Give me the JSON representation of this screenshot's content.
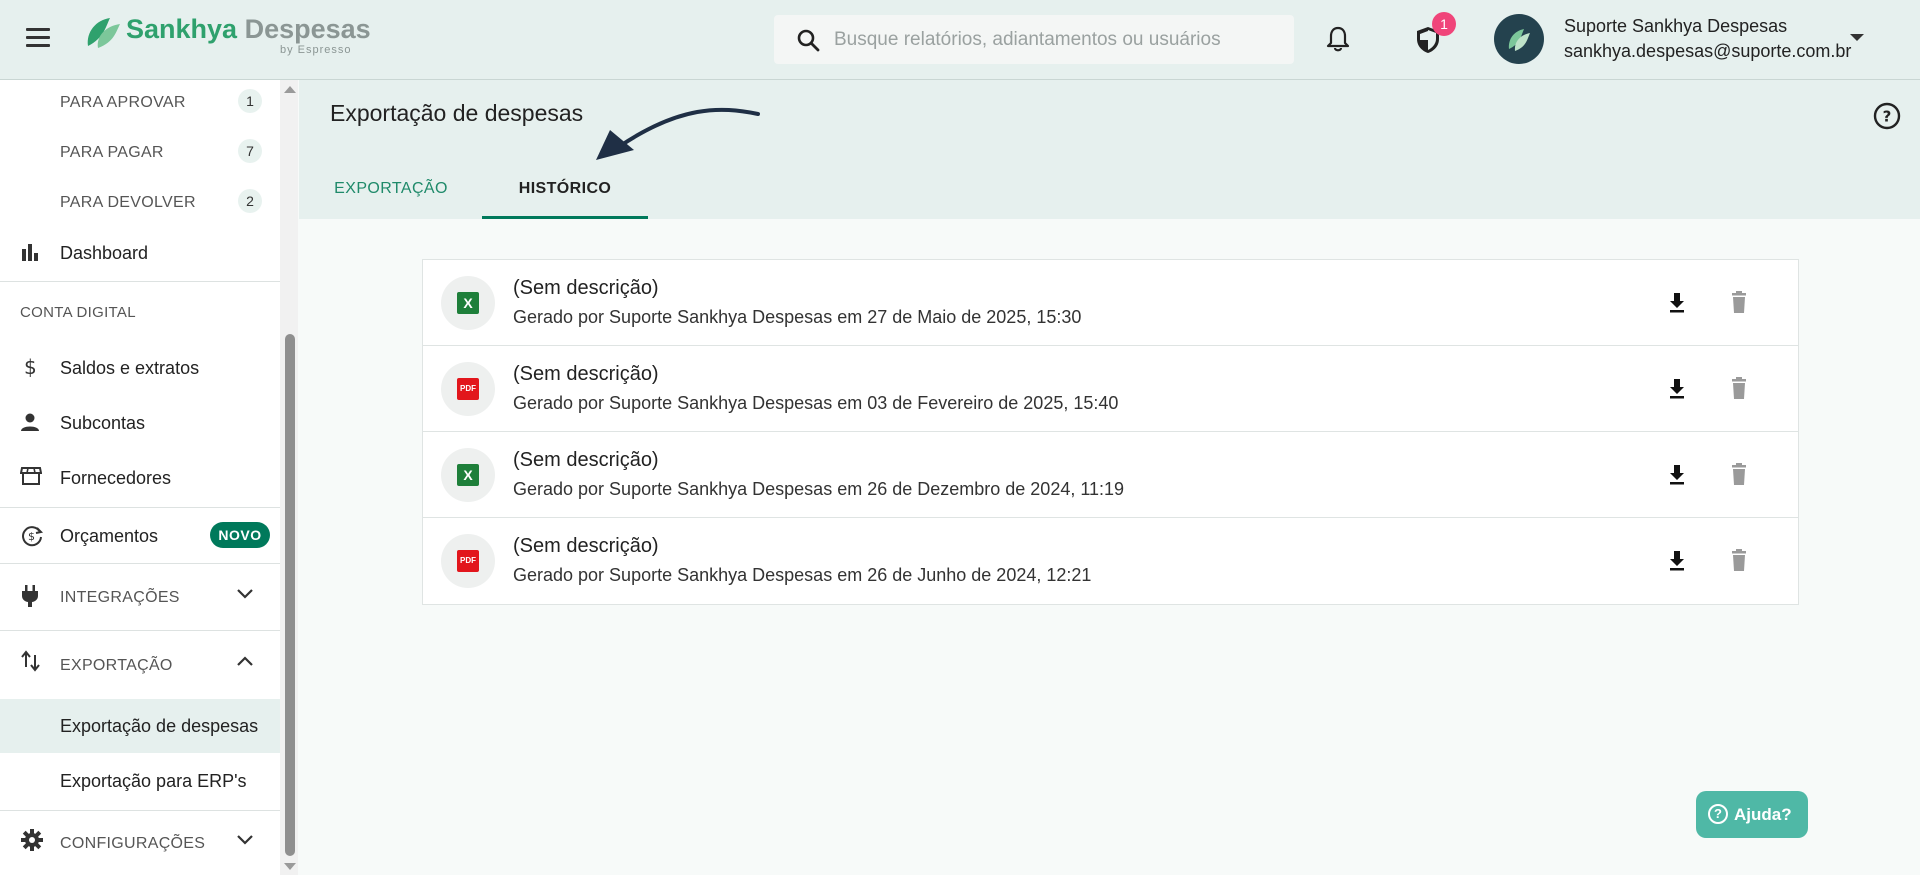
{
  "header": {
    "logo_brand": "Sankhya Despesas",
    "logo_sub": "by Espresso",
    "search_placeholder": "Busque relatórios, adiantamentos ou usuários",
    "notifications_badge": "1",
    "user_name": "Suporte Sankhya Despesas",
    "user_email": "sankhya.despesas@suporte.com.br"
  },
  "sidebar": {
    "approvals": [
      {
        "label": "PARA APROVAR",
        "count": "1"
      },
      {
        "label": "PARA PAGAR",
        "count": "7"
      },
      {
        "label": "PARA DEVOLVER",
        "count": "2"
      }
    ],
    "dashboard": "Dashboard",
    "section_conta": "CONTA DIGITAL",
    "saldos": "Saldos e extratos",
    "subcontas": "Subcontas",
    "fornecedores": "Fornecedores",
    "orcamentos": "Orçamentos",
    "novo_badge": "NOVO",
    "integracoes": "INTEGRAÇÕES",
    "exportacao": "EXPORTAÇÃO",
    "exportacao_despesas": "Exportação de despesas",
    "exportacao_erp": "Exportação para ERP's",
    "configuracoes": "CONFIGURAÇÕES"
  },
  "main": {
    "title": "Exportação de despesas",
    "tabs": [
      {
        "label": "EXPORTAÇÃO",
        "active": false
      },
      {
        "label": "HISTÓRICO",
        "active": true
      }
    ],
    "history": [
      {
        "type": "xls",
        "icon_label": "X",
        "title": "(Sem descrição)",
        "subtitle": "Gerado por Suporte Sankhya Despesas em 27 de Maio de 2025, 15:30"
      },
      {
        "type": "pdf",
        "icon_label": "PDF",
        "title": "(Sem descrição)",
        "subtitle": "Gerado por Suporte Sankhya Despesas em 03 de Fevereiro de 2025, 15:40"
      },
      {
        "type": "xls",
        "icon_label": "X",
        "title": "(Sem descrição)",
        "subtitle": "Gerado por Suporte Sankhya Despesas em 26 de Dezembro de 2024, 11:19"
      },
      {
        "type": "pdf",
        "icon_label": "PDF",
        "title": "(Sem descrição)",
        "subtitle": "Gerado por Suporte Sankhya Despesas em 26 de Junho de 2024, 12:21"
      }
    ]
  },
  "help_button": "Ajuda?",
  "colors": {
    "header_bg": "#e6f0ee",
    "accent": "#00795b",
    "badge": "#f0457a",
    "help": "#4fb8a6",
    "xls": "#1e7f3a",
    "pdf": "#e2161c"
  },
  "icons": [
    "menu-icon",
    "search-icon",
    "bell-icon",
    "shield-icon",
    "bar-chart-icon",
    "dollar-icon",
    "person-icon",
    "store-icon",
    "refresh-dollar-icon",
    "plug-icon",
    "swap-vertical-icon",
    "gear-icon",
    "chevron-down-icon",
    "chevron-up-icon",
    "help-circle-icon",
    "download-icon",
    "trash-icon",
    "arrow-annotation-icon"
  ]
}
